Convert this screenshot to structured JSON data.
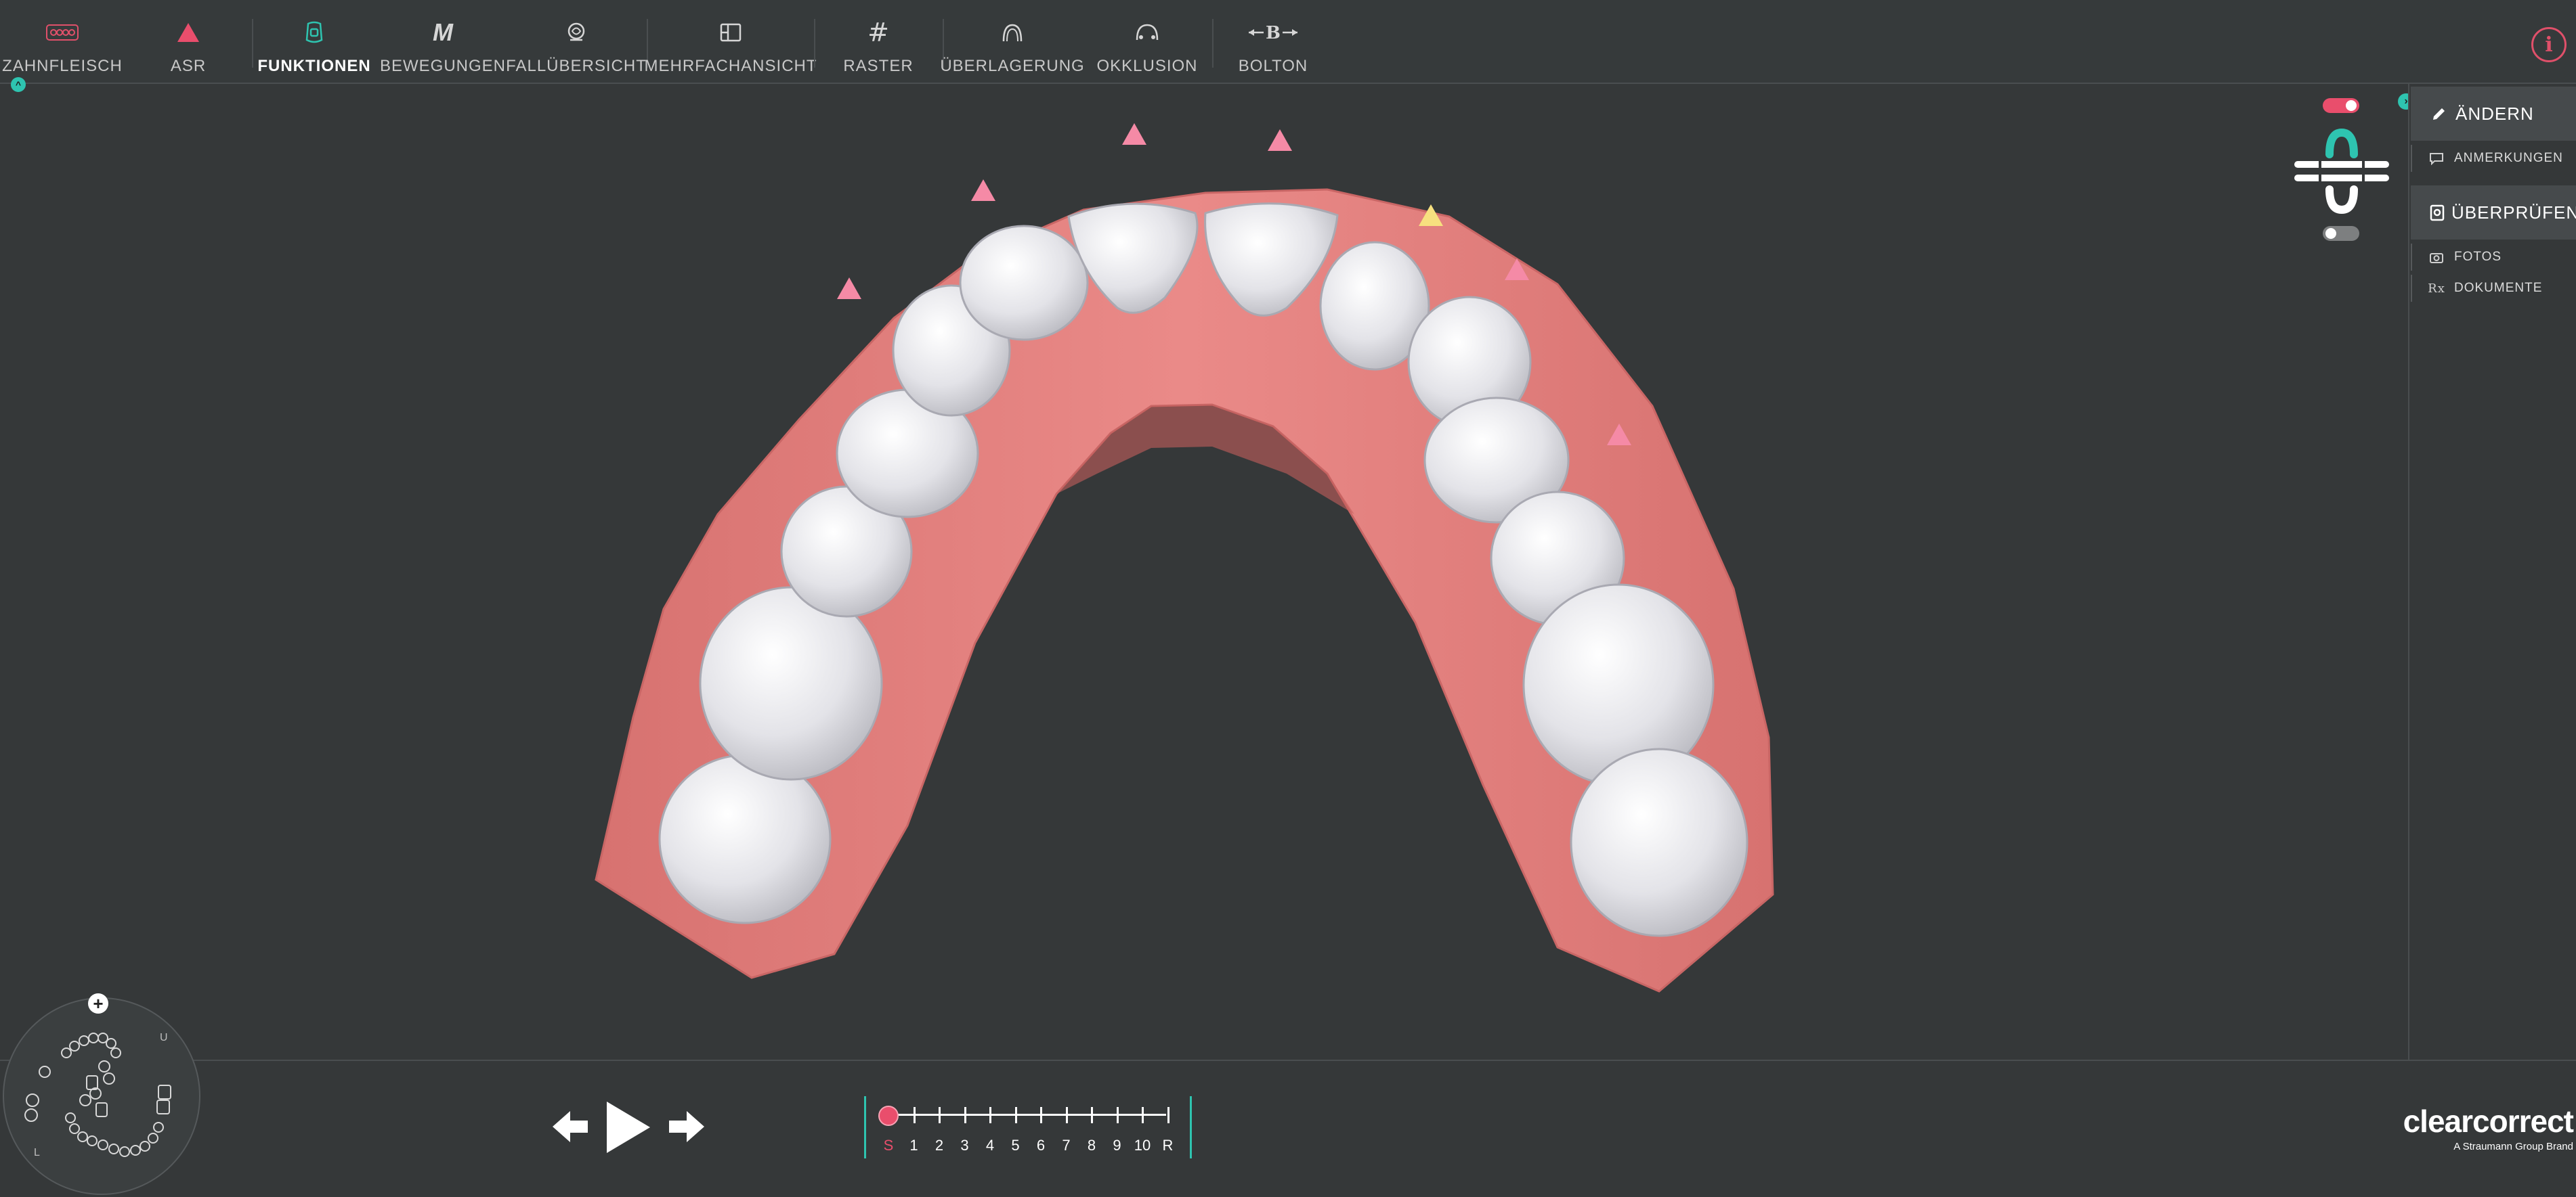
{
  "toolbar": {
    "items": [
      {
        "label": "ZAHNFLEISCH",
        "icon": "gum-icon"
      },
      {
        "label": "ASR",
        "icon": "asr-triangle-icon"
      },
      {
        "label": "FUNKTIONEN",
        "icon": "attachment-tooth-icon"
      },
      {
        "label": "BEWEGUNGEN",
        "icon": "movements-m-icon"
      },
      {
        "label": "FALLÜBERSICHT",
        "icon": "case-overview-icon"
      },
      {
        "label": "MEHRFACHANSICHT",
        "icon": "multi-view-icon"
      },
      {
        "label": "RASTER",
        "icon": "grid-hash-icon"
      },
      {
        "label": "ÜBERLAGERUNG",
        "icon": "overlay-arch-icon"
      },
      {
        "label": "OKKLUSION",
        "icon": "occlusion-icon"
      },
      {
        "label": "BOLTON",
        "icon": "bolton-icon"
      }
    ],
    "active": "FUNKTIONEN",
    "info_icon": "info-icon"
  },
  "side_panel": {
    "modify_label": "ÄNDERN",
    "annotations_label": "ANMERKUNGEN",
    "review_label": "ÜBERPRÜFEN",
    "photos_label": "FOTOS",
    "documents_label": "DOKUMENTE",
    "documents_icon_glyph": "Rx"
  },
  "mini_map": {
    "label_u": "U",
    "label_l": "L",
    "add_icon": "plus-icon"
  },
  "playback": {
    "prev_icon": "arrow-left-icon",
    "play_icon": "play-icon",
    "next_icon": "arrow-right-icon"
  },
  "timeline": {
    "stages": [
      "S",
      "1",
      "2",
      "3",
      "4",
      "5",
      "6",
      "7",
      "8",
      "9",
      "10",
      "R"
    ],
    "current_stage": "S"
  },
  "brand": {
    "name": "clearcorrect",
    "tagline": "A Straumann Group Brand"
  },
  "colors": {
    "accent_teal": "#2ec4b0",
    "asr_pink": "#f58aa6",
    "asr_yellow": "#f7e07f",
    "gum": "#e38383",
    "tooth": "#e8e8ec",
    "info_red": "#e0506a"
  }
}
